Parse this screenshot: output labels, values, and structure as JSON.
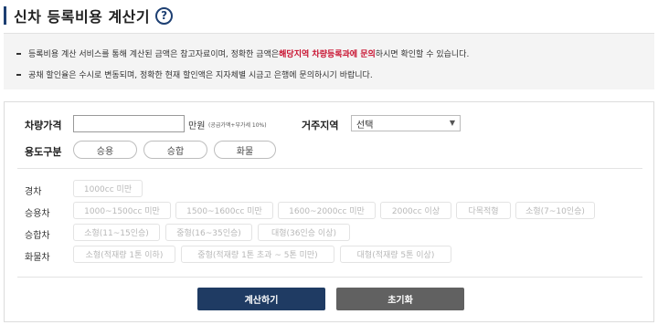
{
  "page": {
    "title": "신차 등록비용 계산기",
    "help_icon": "question-circle-icon"
  },
  "notice": {
    "line1_before": "등록비용 계산 서비스를 통해 계산된 금액은 참고자료이며, 정확한 금액은 ",
    "line1_highlight": "해당지역 차량등록과에 문의",
    "line1_after": "하시면 확인할 수 있습니다.",
    "line2": "공채 할인율은 수시로 변동되며, 정확한 현재 할인액은 지자체별 시금고 은행에 문의하시기 바랍니다."
  },
  "form": {
    "price_label": "차량가격",
    "price_value": "",
    "price_unit": "만원",
    "price_note": "(공급가액+부가세 10%)",
    "region_label": "거주지역",
    "region_selected": "선택",
    "usage_label": "용도구분",
    "usage_options": [
      "승용",
      "승합",
      "화물"
    ]
  },
  "categories": {
    "light": {
      "label": "경차",
      "options": [
        "1000cc 미만"
      ]
    },
    "passenger": {
      "label": "승용차",
      "options": [
        "1000~1500cc 미만",
        "1500~1600cc 미만",
        "1600~2000cc 미만",
        "2000cc 이상",
        "다목적형",
        "소형(7~10인승)"
      ]
    },
    "van": {
      "label": "승합차",
      "options": [
        "소형(11~15인승)",
        "중형(16~35인승)",
        "대형(36인승 이상)"
      ]
    },
    "truck": {
      "label": "화물차",
      "options": [
        "소형(적재량 1톤 이하)",
        "중형(적재량 1톤 초과 ~ 5톤 미만)",
        "대형(적재량 5톤 이상)"
      ]
    }
  },
  "actions": {
    "calculate": "계산하기",
    "reset": "초기화"
  },
  "colors": {
    "accent": "#1d3f72",
    "highlight": "#c8102e",
    "calculate_button": "#1f3b63",
    "reset_button": "#616161"
  }
}
